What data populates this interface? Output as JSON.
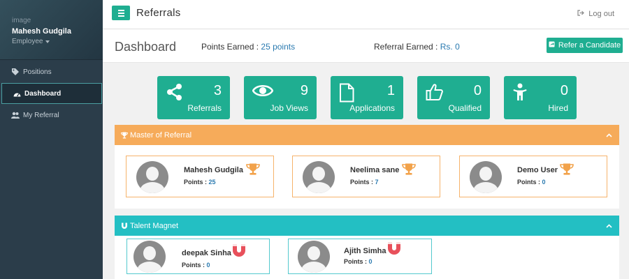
{
  "sidebar": {
    "image_alt": "image",
    "user_name": "Mahesh Gudgila",
    "role": "Employee",
    "items": [
      {
        "label": "Positions",
        "icon": "tag-icon",
        "active": false
      },
      {
        "label": "Dashboard",
        "icon": "dashboard-icon",
        "active": true
      },
      {
        "label": "My Referral",
        "icon": "users-icon",
        "active": false
      }
    ]
  },
  "topbar": {
    "title": "Referrals",
    "logout_label": "Log out"
  },
  "dashboard": {
    "title": "Dashboard",
    "points_earned_label": "Points Earned :",
    "points_earned_value": "25 points",
    "referral_earned_label": "Referral Earned :",
    "referral_earned_value": "Rs. 0",
    "refer_button": "Refer a Candidate"
  },
  "tiles": [
    {
      "count": "3",
      "label": "Referrals",
      "icon": "share-icon"
    },
    {
      "count": "9",
      "label": "Job Views",
      "icon": "eye-icon"
    },
    {
      "count": "1",
      "label": "Applications",
      "icon": "file-icon"
    },
    {
      "count": "0",
      "label": "Qualified",
      "icon": "thumbs-up-icon"
    },
    {
      "count": "0",
      "label": "Hired",
      "icon": "person-icon"
    }
  ],
  "master_panel": {
    "title": "Master of Referral",
    "color": "#f6ab5a",
    "cards": [
      {
        "name": "Mahesh Gudgila",
        "points_label": "Points :",
        "points": "25"
      },
      {
        "name": "Neelima sane",
        "points_label": "Points :",
        "points": "7"
      },
      {
        "name": "Demo User",
        "points_label": "Points :",
        "points": "0"
      }
    ]
  },
  "talent_panel": {
    "title": "Talent Magnet",
    "color": "#23bfc3",
    "cards": [
      {
        "name": "deepak Sinha",
        "points_label": "Points :",
        "points": "0"
      },
      {
        "name": "Ajith Simha",
        "points_label": "Points :",
        "points": "0"
      }
    ]
  },
  "colors": {
    "accent": "#1fae91",
    "sidebar": "#2b3d4a",
    "link": "#2a7ab0",
    "trophy": "#f2a24a",
    "magnet": "#e8505b"
  }
}
